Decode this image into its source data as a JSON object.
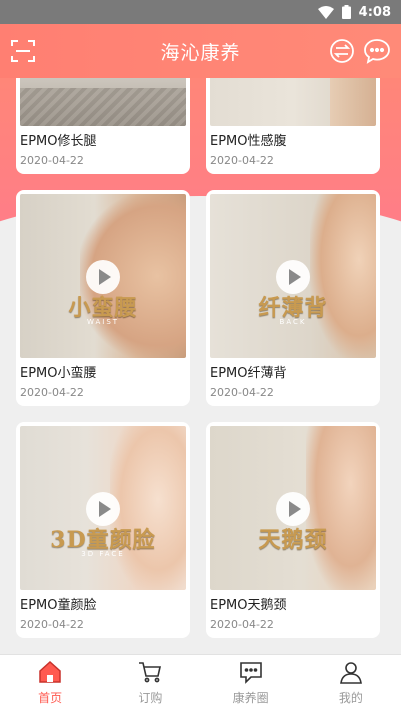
{
  "status": {
    "time": "4:08"
  },
  "header": {
    "title": "海沁康养"
  },
  "colors": {
    "brand": "#ff7f72",
    "active_tab": "#ff5a50"
  },
  "cards": [
    {
      "name": "EPMO修长腿",
      "date": "2020-04-22"
    },
    {
      "name": "EPMO性感腹",
      "date": "2020-04-22"
    },
    {
      "name": "EPMO小蛮腰",
      "date": "2020-04-22",
      "overlay": "小蛮腰",
      "overlay_sub": "WAIST"
    },
    {
      "name": "EPMO纤薄背",
      "date": "2020-04-22",
      "overlay": "纤薄背",
      "overlay_sub": "BACK"
    },
    {
      "name": "EPMO童颜脸",
      "date": "2020-04-22",
      "overlay": "3D童颜脸",
      "overlay_sub": "3D FACE"
    },
    {
      "name": "EPMO天鹅颈",
      "date": "2020-04-22",
      "overlay": "天鹅颈",
      "overlay_sub": ""
    }
  ],
  "tabs": [
    {
      "label": "首页",
      "icon": "home-icon",
      "active": true
    },
    {
      "label": "订购",
      "icon": "cart-icon",
      "active": false
    },
    {
      "label": "康养圈",
      "icon": "message-icon",
      "active": false
    },
    {
      "label": "我的",
      "icon": "user-icon",
      "active": false
    }
  ]
}
